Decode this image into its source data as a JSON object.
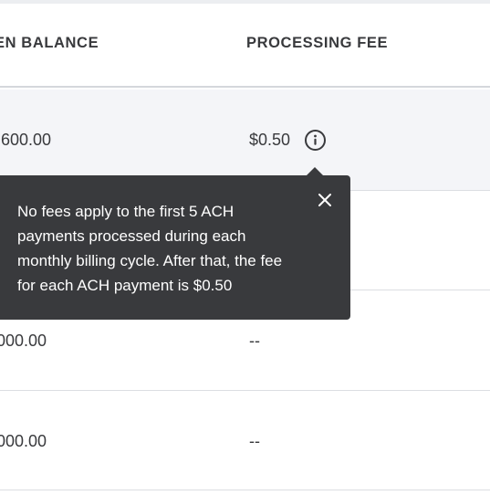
{
  "table": {
    "columns": {
      "balance_header": "EN BALANCE",
      "fee_header": "PROCESSING FEE"
    },
    "rows": [
      {
        "balance": ",600.00",
        "fee": "$0.50"
      },
      {
        "balance": "",
        "fee": ""
      },
      {
        "balance": "000.00",
        "fee": "--"
      },
      {
        "balance": "000.00",
        "fee": "--"
      }
    ]
  },
  "tooltip": {
    "text": "No fees apply to the first 5 ACH payments processed during each monthly billing cycle. After that, the fee for each ACH payment is $0.50",
    "close_icon": "close-icon"
  },
  "icons": {
    "info": "info-icon"
  },
  "colors": {
    "text": "#393a3d",
    "tooltip_bg": "#393a3d",
    "highlight_row": "#f4f5f8",
    "divider": "#dcdee2"
  }
}
